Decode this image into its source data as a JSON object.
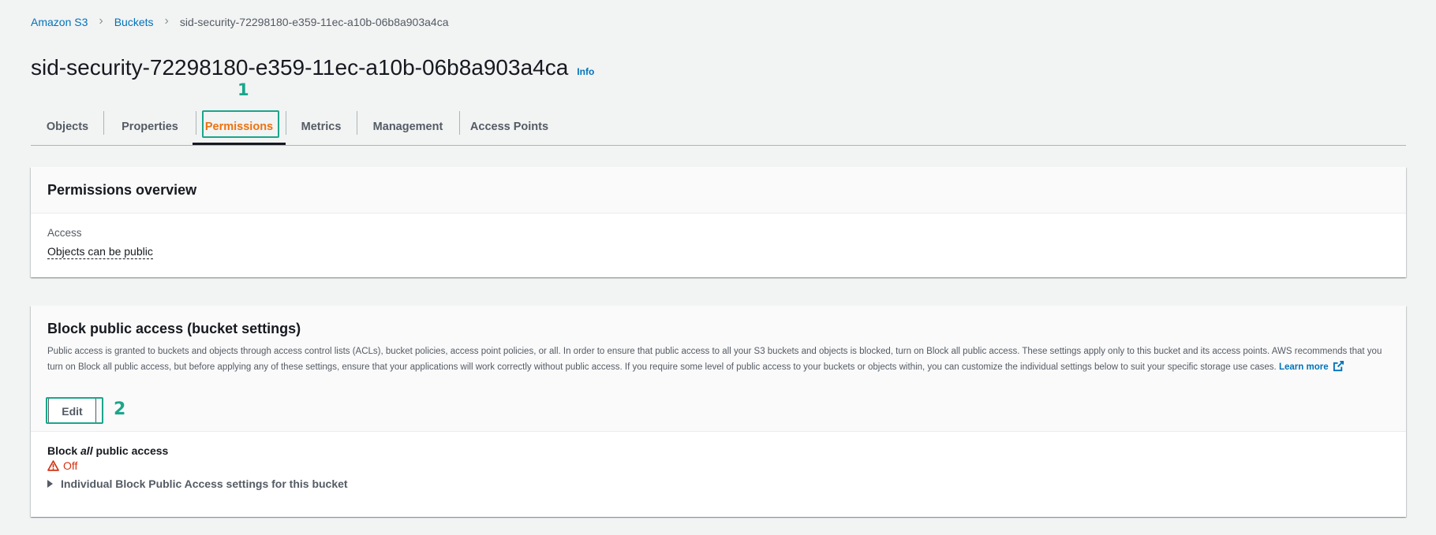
{
  "breadcrumb": {
    "items": [
      "Amazon S3",
      "Buckets"
    ],
    "current": "sid-security-72298180-e359-11ec-a10b-06b8a903a4ca"
  },
  "page": {
    "title": "sid-security-72298180-e359-11ec-a10b-06b8a903a4ca",
    "info": "Info"
  },
  "annotations": {
    "step1": "1",
    "step2": "2"
  },
  "tabs": [
    {
      "label": "Objects"
    },
    {
      "label": "Properties"
    },
    {
      "label": "Permissions",
      "active": true
    },
    {
      "label": "Metrics"
    },
    {
      "label": "Management"
    },
    {
      "label": "Access Points"
    }
  ],
  "overview": {
    "title": "Permissions overview",
    "access_label": "Access",
    "access_value": "Objects can be public"
  },
  "block_public_access": {
    "title": "Block public access (bucket settings)",
    "description": "Public access is granted to buckets and objects through access control lists (ACLs), bucket policies, access point policies, or all. In order to ensure that public access to all your S3 buckets and objects is blocked, turn on Block all public access. These settings apply only to this bucket and its access points. AWS recommends that you turn on Block all public access, but before applying any of these settings, ensure that your applications will work correctly without public access. If you require some level of public access to your buckets or objects within, you can customize the individual settings below to suit your specific storage use cases.",
    "learn_more": "Learn more",
    "edit_label": "Edit",
    "block_all_prefix": "Block",
    "block_all_emphasis": "all",
    "block_all_suffix": "public access",
    "status": "Off",
    "individual_settings": "Individual Block Public Access settings for this bucket"
  },
  "colors": {
    "link": "#0073bb",
    "active_tab": "#ec7211",
    "annotation": "#1aa68a",
    "status_off": "#d13212"
  },
  "icons": {
    "breadcrumb_separator": "chevron-right-icon",
    "learn_more": "external-link-icon",
    "status": "warning-icon",
    "expander": "caret-right-icon"
  }
}
